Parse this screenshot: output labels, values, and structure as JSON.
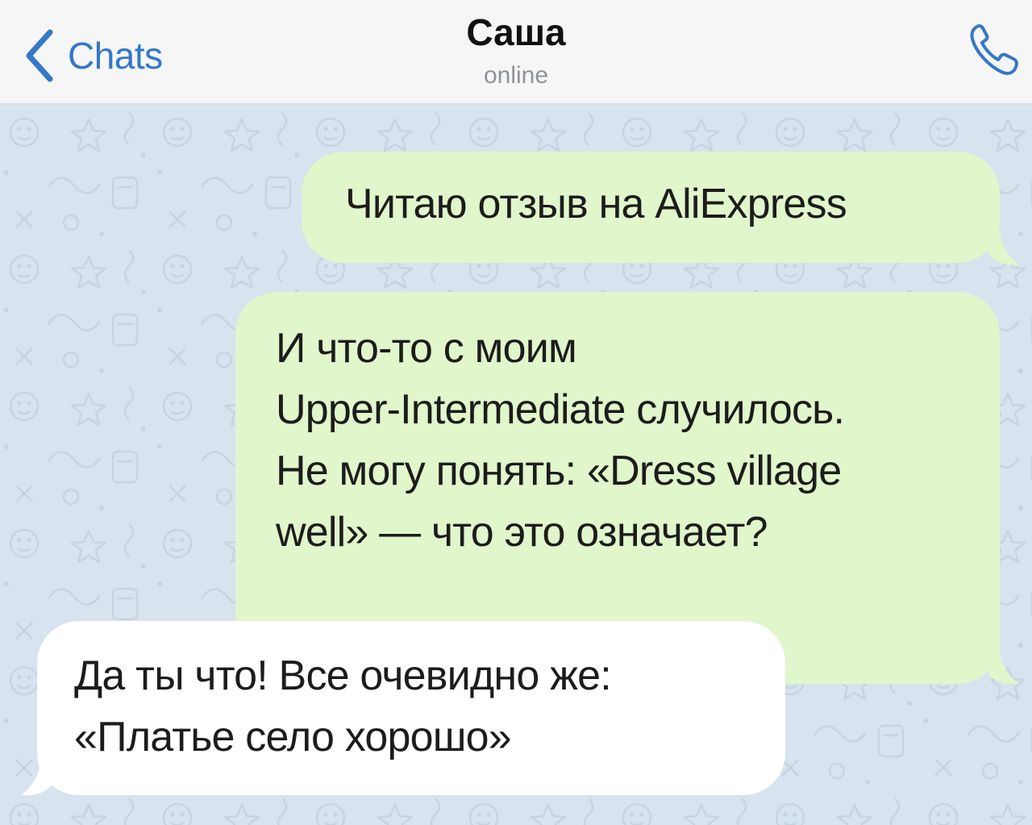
{
  "header": {
    "back_label": "Chats",
    "title": "Саша",
    "status": "online"
  },
  "icons": {
    "back": "chevron-left-icon",
    "call": "phone-icon"
  },
  "colors": {
    "accent": "#3478c8",
    "outgoing_bubble": "#e1f6cb",
    "incoming_bubble": "#ffffff",
    "chat_background": "#d7e3ee",
    "header_background": "#f6f6f7"
  },
  "messages": [
    {
      "direction": "outgoing",
      "lines": [
        "Читаю отзыв на AliExpress"
      ]
    },
    {
      "direction": "outgoing",
      "lines": [
        "И что-то с моим",
        "Upper-Intermediate случилось.",
        "Не могу понять: «Dress village",
        "well» — что это означает?"
      ]
    },
    {
      "direction": "incoming",
      "lines": [
        "Да ты что! Все очевидно же:",
        "«Платье село хорошо»"
      ]
    }
  ]
}
